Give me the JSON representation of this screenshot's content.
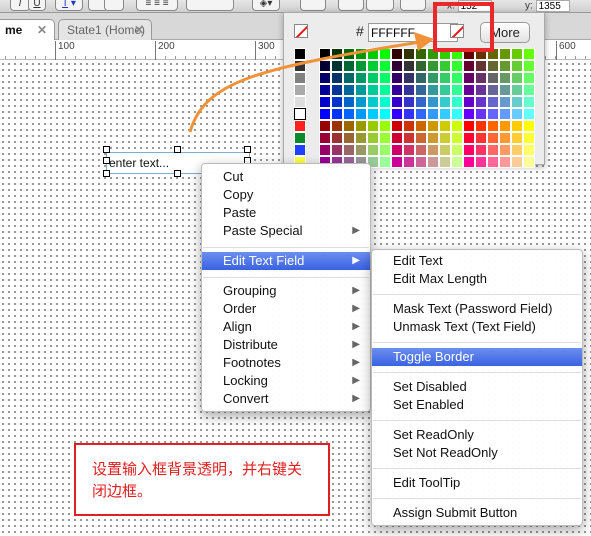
{
  "toolbar": {
    "italic": "I",
    "underline": "U",
    "text_color": "T",
    "x_label": "x:",
    "x_value": "152",
    "y_label": "y:",
    "y_value": "1355"
  },
  "tabs": [
    {
      "label": "me",
      "active": true
    },
    {
      "label": "State1 (Home)",
      "active": false
    }
  ],
  "ruler": [
    "100",
    "200",
    "300",
    "600"
  ],
  "color_popup": {
    "hash": "#",
    "hex_value": "FFFFFF",
    "more_label": "More",
    "grayscale": [
      "#000000",
      "#333333",
      "#808080",
      "#aaaaaa",
      "#dddddd",
      "#ffffff",
      "#ff2020",
      "#0a8a2a",
      "#2040ff",
      "#ffff40"
    ]
  },
  "text_field": {
    "value": "enter text..."
  },
  "context_menu": {
    "items": [
      "Cut",
      "Copy",
      "Paste",
      "Paste Special",
      "Edit Text Field",
      "Grouping",
      "Order",
      "Align",
      "Distribute",
      "Footnotes",
      "Locking",
      "Convert"
    ],
    "highlighted": "Edit Text Field"
  },
  "submenu": {
    "items": [
      "Edit Text",
      "Edit Max Length",
      "Mask Text (Password Field)",
      "Unmask Text (Text Field)",
      "Toggle Border",
      "Set Disabled",
      "Set Enabled",
      "Set ReadOnly",
      "Set Not ReadOnly",
      "Edit ToolTip",
      "Assign Submit Button"
    ],
    "highlighted": "Toggle Border"
  },
  "annotation": {
    "text": "设置输入框背景透明，并右键关闭边框。"
  },
  "colors": {
    "highlight": "#3a62e2",
    "annotation": "#e02020",
    "arrow": "#f0923a"
  }
}
